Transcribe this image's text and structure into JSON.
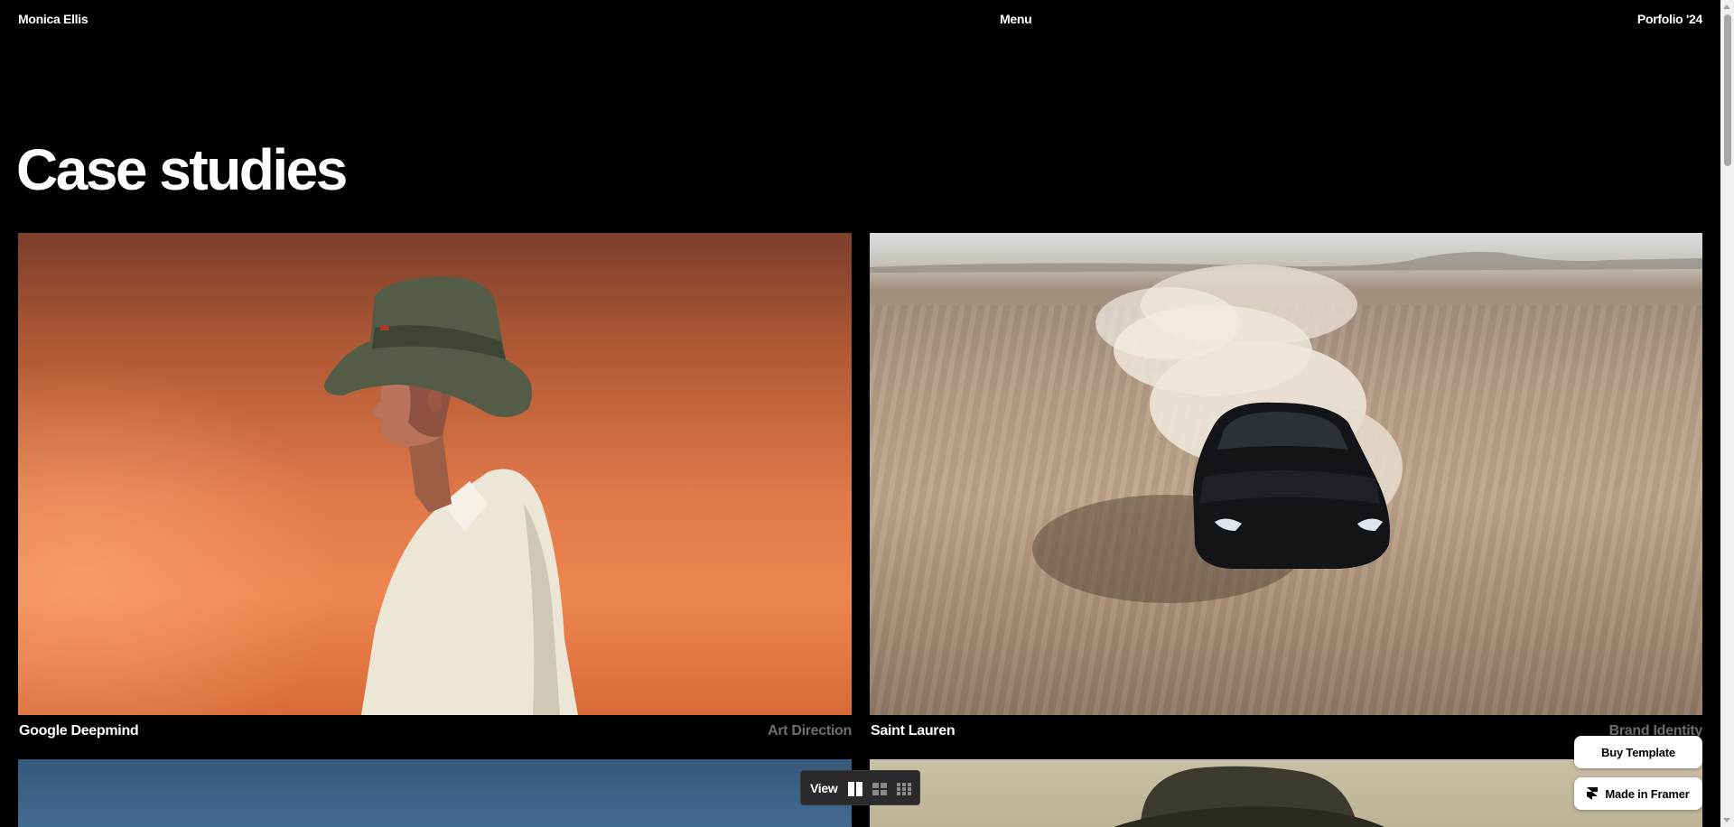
{
  "header": {
    "brand": "Monica Ellis",
    "menu_label": "Menu",
    "portfolio_label": "Porfolio '24"
  },
  "page_title": "Case studies",
  "projects": [
    {
      "title": "Google Deepmind",
      "category": "Art Direction",
      "image": "portrait-bucket-hat-orange-background"
    },
    {
      "title": "Saint Lauren",
      "category": "Brand Identity",
      "image": "black-car-drifting-desert-dust"
    },
    {
      "title": "",
      "category": "",
      "image": "blue-sky"
    },
    {
      "title": "",
      "category": "",
      "image": "hat-beige-background"
    }
  ],
  "view_toolbar": {
    "label": "View",
    "options": [
      "two-column-icon",
      "grid-2x2-icon",
      "grid-3x3-icon"
    ],
    "active": "two-column-icon"
  },
  "floating": {
    "buy_label": "Buy Template",
    "framer_label": "Made in Framer"
  },
  "colors": {
    "background": "#000000",
    "text": "#ffffff",
    "muted": "#6e6e6e"
  }
}
